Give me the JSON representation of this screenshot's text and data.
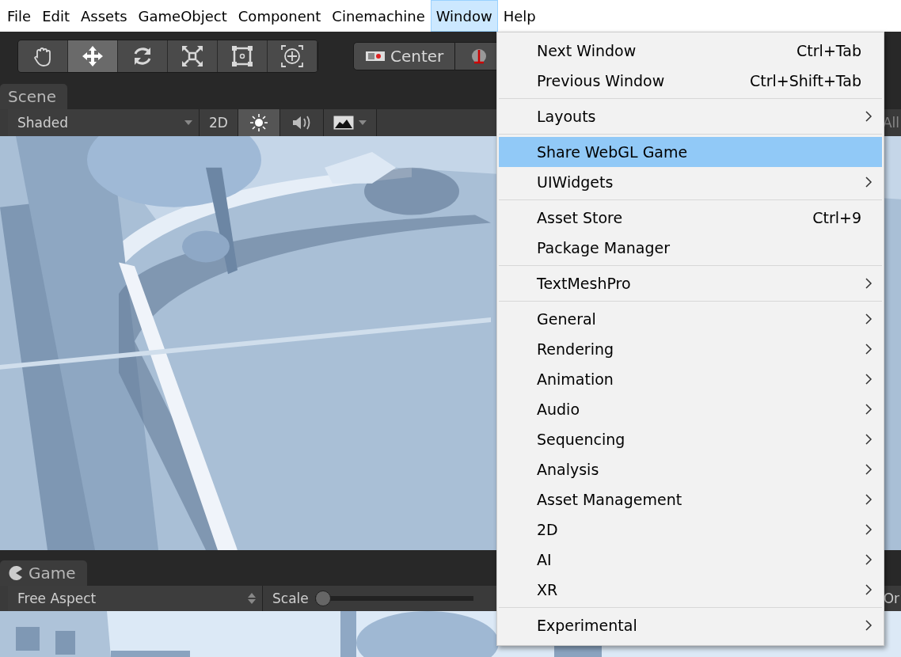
{
  "menu_bar": [
    {
      "label": "File",
      "selected": false
    },
    {
      "label": "Edit",
      "selected": false
    },
    {
      "label": "Assets",
      "selected": false
    },
    {
      "label": "GameObject",
      "selected": false
    },
    {
      "label": "Component",
      "selected": false
    },
    {
      "label": "Cinemachine",
      "selected": false
    },
    {
      "label": "Window",
      "selected": true
    },
    {
      "label": "Help",
      "selected": false
    }
  ],
  "tools": [
    {
      "kind": "hand",
      "selected": false
    },
    {
      "kind": "move",
      "selected": true
    },
    {
      "kind": "rotate",
      "selected": false
    },
    {
      "kind": "scale",
      "selected": false
    },
    {
      "kind": "rect",
      "selected": false
    },
    {
      "kind": "transform",
      "selected": false
    }
  ],
  "pivot_button": {
    "label": "Center"
  },
  "scene": {
    "tab": "Scene",
    "shading": "Shaded",
    "mode_2d": "2D",
    "lighting_on": true,
    "audio_on": false,
    "trailing_text": "All"
  },
  "game": {
    "tab": "Game",
    "aspect": "Free Aspect",
    "scale_label": "Scale",
    "scale": {
      "level": 0
    },
    "trailing_text": "Or"
  },
  "window_menu": [
    [
      {
        "label": "Next Window",
        "shortcut": "Ctrl+Tab",
        "submenu": false,
        "selected": false
      },
      {
        "label": "Previous Window",
        "shortcut": "Ctrl+Shift+Tab",
        "submenu": false,
        "selected": false
      }
    ],
    [
      {
        "label": "Layouts",
        "submenu": true,
        "selected": false
      }
    ],
    [
      {
        "label": "Share WebGL Game",
        "submenu": false,
        "selected": true
      },
      {
        "label": "UIWidgets",
        "submenu": true,
        "selected": false
      }
    ],
    [
      {
        "label": "Asset Store",
        "shortcut": "Ctrl+9",
        "submenu": false,
        "selected": false
      },
      {
        "label": "Package Manager",
        "submenu": false,
        "selected": false
      }
    ],
    [
      {
        "label": "TextMeshPro",
        "submenu": true,
        "selected": false
      }
    ],
    [
      {
        "label": "General",
        "submenu": true,
        "selected": false
      },
      {
        "label": "Rendering",
        "submenu": true,
        "selected": false
      },
      {
        "label": "Animation",
        "submenu": true,
        "selected": false
      },
      {
        "label": "Audio",
        "submenu": true,
        "selected": false
      },
      {
        "label": "Sequencing",
        "submenu": true,
        "selected": false
      },
      {
        "label": "Analysis",
        "submenu": true,
        "selected": false
      },
      {
        "label": "Asset Management",
        "submenu": true,
        "selected": false
      },
      {
        "label": "2D",
        "submenu": true,
        "selected": false
      },
      {
        "label": "AI",
        "submenu": true,
        "selected": false
      },
      {
        "label": "XR",
        "submenu": true,
        "selected": false
      }
    ],
    [
      {
        "label": "Experimental",
        "submenu": true,
        "selected": false
      }
    ]
  ]
}
